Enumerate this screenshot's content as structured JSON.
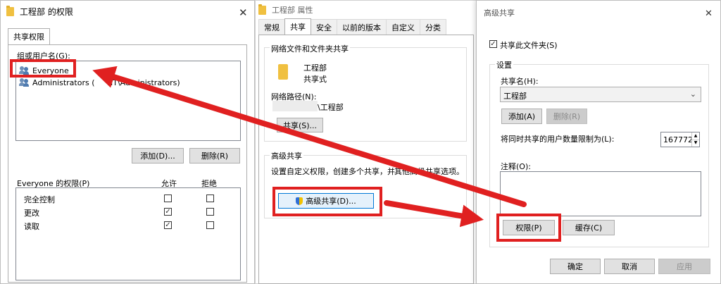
{
  "perm_dialog": {
    "title": "工程部 的权限",
    "tab": "共享权限",
    "group_label": "组或用户名(G):",
    "users": [
      "Everyone",
      "Administrators (",
      "NT\\Administrators)"
    ],
    "add_button": "添加(D)...",
    "remove_button": "删除(R)",
    "perm_header": "Everyone 的权限(P)",
    "col_allow": "允许",
    "col_deny": "拒绝",
    "permissions": [
      {
        "name": "完全控制",
        "allow": false,
        "deny": false
      },
      {
        "name": "更改",
        "allow": true,
        "deny": false
      },
      {
        "name": "读取",
        "allow": true,
        "deny": false
      }
    ]
  },
  "props_dialog": {
    "title": "工程部 属性",
    "tabs": [
      "常规",
      "共享",
      "安全",
      "以前的版本",
      "自定义",
      "分类"
    ],
    "section_network": "网络文件和文件夹共享",
    "folder_name": "工程部",
    "share_state": "共享式",
    "network_path_label": "网络路径(N):",
    "network_path_value": "\\工程部",
    "share_button": "共享(S)...",
    "section_advanced": "高级共享",
    "advanced_desc_1": "设置自定义权限，创建多个共享，并",
    "advanced_desc_2": "其他高级共享选项。",
    "advanced_button": "高级共享(D)..."
  },
  "adv_dialog": {
    "title": "高级共享",
    "share_checkbox": "共享此文件夹(S)",
    "share_checked": true,
    "settings_label": "设置",
    "share_name_label": "共享名(H):",
    "share_name_value": "工程部",
    "add_button": "添加(A)",
    "remove_button": "删除(R)",
    "limit_label": "将同时共享的用户数量限制为(L):",
    "limit_value": "167772",
    "comment_label": "注释(O):",
    "permissions_button": "权限(P)",
    "cache_button": "缓存(C)",
    "ok_button": "确定",
    "cancel_button": "取消",
    "apply_button": "应用"
  },
  "colors": {
    "highlight": "#e02020",
    "accent": "#0078d7"
  },
  "icons": [
    "folder-icon",
    "close-icon",
    "user-group-icon",
    "shield-icon",
    "chevron-down-icon",
    "spin-up-icon",
    "spin-down-icon"
  ]
}
